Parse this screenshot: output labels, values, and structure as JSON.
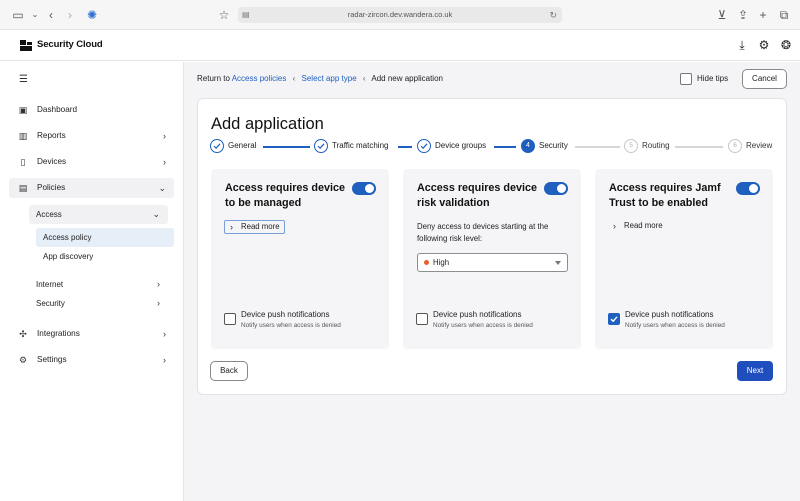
{
  "browser": {
    "url": "radar-zircon.dev.wandera.co.uk"
  },
  "header": {
    "app_name": "Security Cloud",
    "icons": [
      "download-icon",
      "gear-icon",
      "help-icon"
    ]
  },
  "sidebar": {
    "items": [
      {
        "label": "Dashboard",
        "icon": "dashboard-icon"
      },
      {
        "label": "Reports",
        "icon": "chart-icon"
      },
      {
        "label": "Devices",
        "icon": "phone-icon"
      },
      {
        "label": "Policies",
        "icon": "folder-icon"
      },
      {
        "label": "Integrations",
        "icon": "puzzle-icon"
      },
      {
        "label": "Settings",
        "icon": "gear-icon"
      }
    ],
    "policies_sub": {
      "access": "Access",
      "access_policy": "Access policy",
      "app_discovery": "App discovery",
      "internet": "Internet",
      "security": "Security"
    }
  },
  "breadcrumb": {
    "return_to": "Return to",
    "access_policies": "Access policies",
    "select_app_type": "Select app type",
    "current": "Add new application"
  },
  "toolbar": {
    "hide_tips": "Hide tips",
    "cancel": "Cancel"
  },
  "page": {
    "title": "Add application"
  },
  "steps": [
    {
      "label": "General",
      "state": "done"
    },
    {
      "label": "Traffic matching",
      "state": "done"
    },
    {
      "label": "Device groups",
      "state": "done"
    },
    {
      "label": "Security",
      "number": "4",
      "state": "active"
    },
    {
      "label": "Routing",
      "number": "5",
      "state": "todo"
    },
    {
      "label": "Review",
      "number": "6",
      "state": "todo"
    }
  ],
  "cards": {
    "managed": {
      "title": "Access requires device to be managed",
      "read_more": "Read more",
      "enabled": true,
      "notif_label": "Device push notifications",
      "notif_sub": "Notify users when access is denied",
      "notif_checked": false
    },
    "risk": {
      "title": "Access requires device risk validation",
      "description": "Deny access to devices starting at the following risk level:",
      "risk_level": "High",
      "risk_color": "#e8602c",
      "enabled": true,
      "notif_label": "Device push notifications",
      "notif_sub": "Notify users when access is denied",
      "notif_checked": false
    },
    "jamf": {
      "title": "Access requires Jamf Trust to be enabled",
      "read_more": "Read more",
      "enabled": true,
      "notif_label": "Device push notifications",
      "notif_sub": "Notify users when access is denied",
      "notif_checked": true
    }
  },
  "footer": {
    "back": "Back",
    "next": "Next"
  },
  "colors": {
    "accent": "#1f5fbf",
    "primary_button": "#1f4fbf"
  }
}
